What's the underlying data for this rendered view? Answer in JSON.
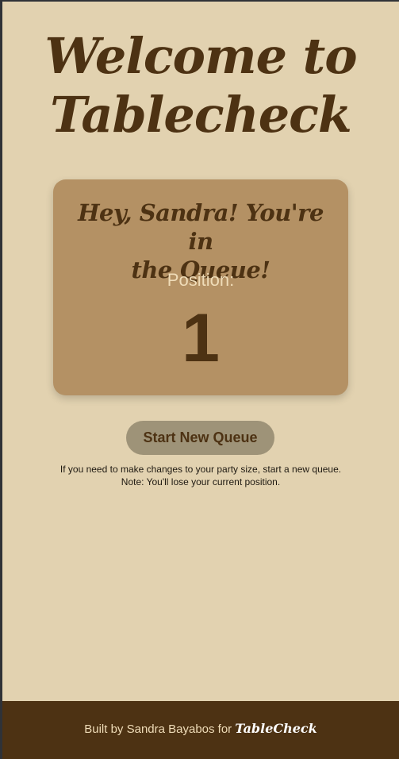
{
  "header": {
    "title_line1": "Welcome to",
    "title_line2": "Tablecheck"
  },
  "queue_card": {
    "heading_line1": "Hey, Sandra! You're in",
    "heading_line2": "the Queue!",
    "position_label": "Position:",
    "position_value": "1"
  },
  "actions": {
    "start_new_queue_label": "Start New Queue"
  },
  "note": {
    "line1": "If you need to make changes to your party size, start a new queue.",
    "line2": "Note: You'll lose your current position."
  },
  "footer": {
    "credit": "Built by Sandra Bayabos for",
    "brand": "TableCheck"
  },
  "colors": {
    "page_background": "#e2d2b0",
    "accent_brown": "#4d3213",
    "card_background": "#b49164",
    "button_background": "#9e9378"
  }
}
